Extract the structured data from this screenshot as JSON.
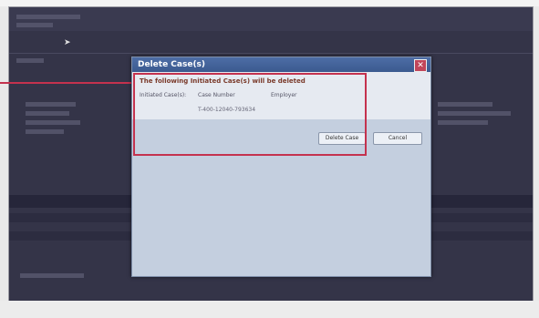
{
  "dialog": {
    "title": "Delete Case(s)",
    "close_glyph": "✕",
    "message": "The following Initiated Case(s) will be deleted",
    "initiated_label": "Initiated Case(s):",
    "col_case_number": "Case Number",
    "col_employer": "Employer",
    "case_number_value": "T-400-12040-793634",
    "delete_button": "Delete Case",
    "cancel_button": "Cancel"
  },
  "colors": {
    "highlight": "#c4324e",
    "titlebar": "#3b5a8f",
    "dialog_body": "#c4cfdf"
  },
  "icons": {
    "cursor": "mouse-pointer-icon",
    "close": "close-icon"
  }
}
